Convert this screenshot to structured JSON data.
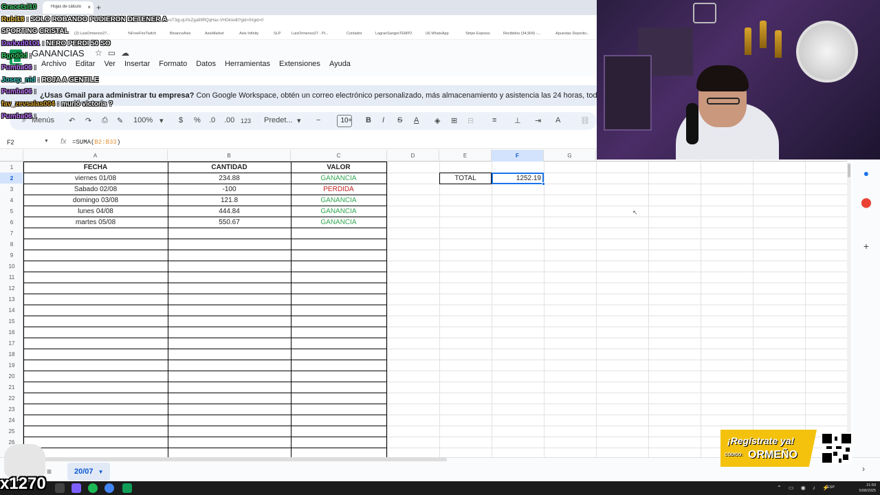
{
  "browser": {
    "tab_title": "Hojas de cálculo",
    "url": "a6-voT3qj-qU0cZga99RQqHax-VHOk/edit?gid=0#gid=0",
    "bookmarks": [
      "(2) LuisOrmenoo27...",
      "%FreeFireTwitch",
      "BinanceAxie",
      "AxieMarket",
      "Axie Infinity",
      "SLP",
      "LuisOrmenoo27 - Pl...",
      "Contador",
      "LagranSangreTEMP2",
      "(4) WhatsApp",
      "Stripe Express",
      "Recibidos (34,904) -...",
      "Apuestas Deportiv..."
    ]
  },
  "sheets": {
    "doc_title": "GANANCIAS",
    "menu": [
      "Archivo",
      "Editar",
      "Ver",
      "Insertar",
      "Formato",
      "Datos",
      "Herramientas",
      "Extensiones",
      "Ayuda"
    ],
    "promo_bold": "¿Usas Gmail para administrar tu empresa?",
    "promo_text": "Con Google Workspace, obtén un correo electrónico personalizado, más almacenamiento y asistencia las 24 horas, todos",
    "toolbar": {
      "search": "Menús",
      "zoom": "100%",
      "currency": "$",
      "percent": "%",
      "dec_less": ".0",
      "dec_more": ".00",
      "number_format": "123",
      "font": "Predet...",
      "font_size": "10"
    },
    "name_box": "F2",
    "formula_prefix": "=SUMA(",
    "formula_ref": "B2:B33",
    "formula_suffix": ")",
    "columns": [
      "A",
      "B",
      "C",
      "D",
      "E",
      "F",
      "G"
    ],
    "rows": [
      "1",
      "2",
      "3",
      "4",
      "5",
      "6",
      "7",
      "8",
      "9",
      "10",
      "11",
      "12",
      "13",
      "14",
      "15",
      "16",
      "17",
      "18",
      "19",
      "20",
      "21",
      "22",
      "23",
      "24",
      "25",
      "26"
    ],
    "table": {
      "headers": [
        "FECHA",
        "CANTIDAD",
        "VALOR"
      ],
      "rows": [
        {
          "fecha": "viernes 01/08",
          "cantidad": "234.88",
          "valor": "GANANCIA"
        },
        {
          "fecha": "Sabado 02/08",
          "cantidad": "-100",
          "valor": "PERDIDA"
        },
        {
          "fecha": "domingo 03/08",
          "cantidad": "121.8",
          "valor": "GANANCIA"
        },
        {
          "fecha": "lunes 04/08",
          "cantidad": "444.84",
          "valor": "GANANCIA"
        },
        {
          "fecha": "martes 05/08",
          "cantidad": "550.67",
          "valor": "GANANCIA"
        }
      ]
    },
    "total_label": "TOTAL",
    "total_value": "1252.19",
    "sheet_tab": "20/07"
  },
  "chat": [
    {
      "user": "Gracetsi10",
      "msg": "",
      "color": "#3fd16b"
    },
    {
      "user": "Rubi18",
      "msg": ": SOLO ROBANDO PUDIERON DETENER A",
      "color": "#f2c94c"
    },
    {
      "user": "",
      "msg": "SPORTING CRISTAL",
      "color": "#ffffff"
    },
    {
      "user": "Darkxd0101",
      "msg": ": NERO PERDI 50 SO",
      "color": "#b06cff"
    },
    {
      "user": "Bgoddd",
      "msg": ":",
      "color": "#3fd16b"
    },
    {
      "user": "Pumba06",
      "msg": ":",
      "color": "#c77dff"
    },
    {
      "user": "Josep_nid",
      "msg": ": ROJA A GENTILE",
      "color": "#3fd1c9"
    },
    {
      "user": "Pumba06",
      "msg": ":",
      "color": "#c77dff"
    },
    {
      "user": "fav_zevsalas004",
      "msg": ": murió victoria ?",
      "color": "#d9a52c"
    },
    {
      "user": "Pumba06",
      "msg": ":",
      "color": "#c77dff"
    }
  ],
  "sponsor": {
    "cta": "¡Regístrate ya!",
    "code_label": "CÓDIGO:",
    "code": "ORMEÑO"
  },
  "emote_text": "x1270",
  "taskbar": {
    "lang": "ESP",
    "time": "21:59",
    "date": "5/08/2025"
  }
}
